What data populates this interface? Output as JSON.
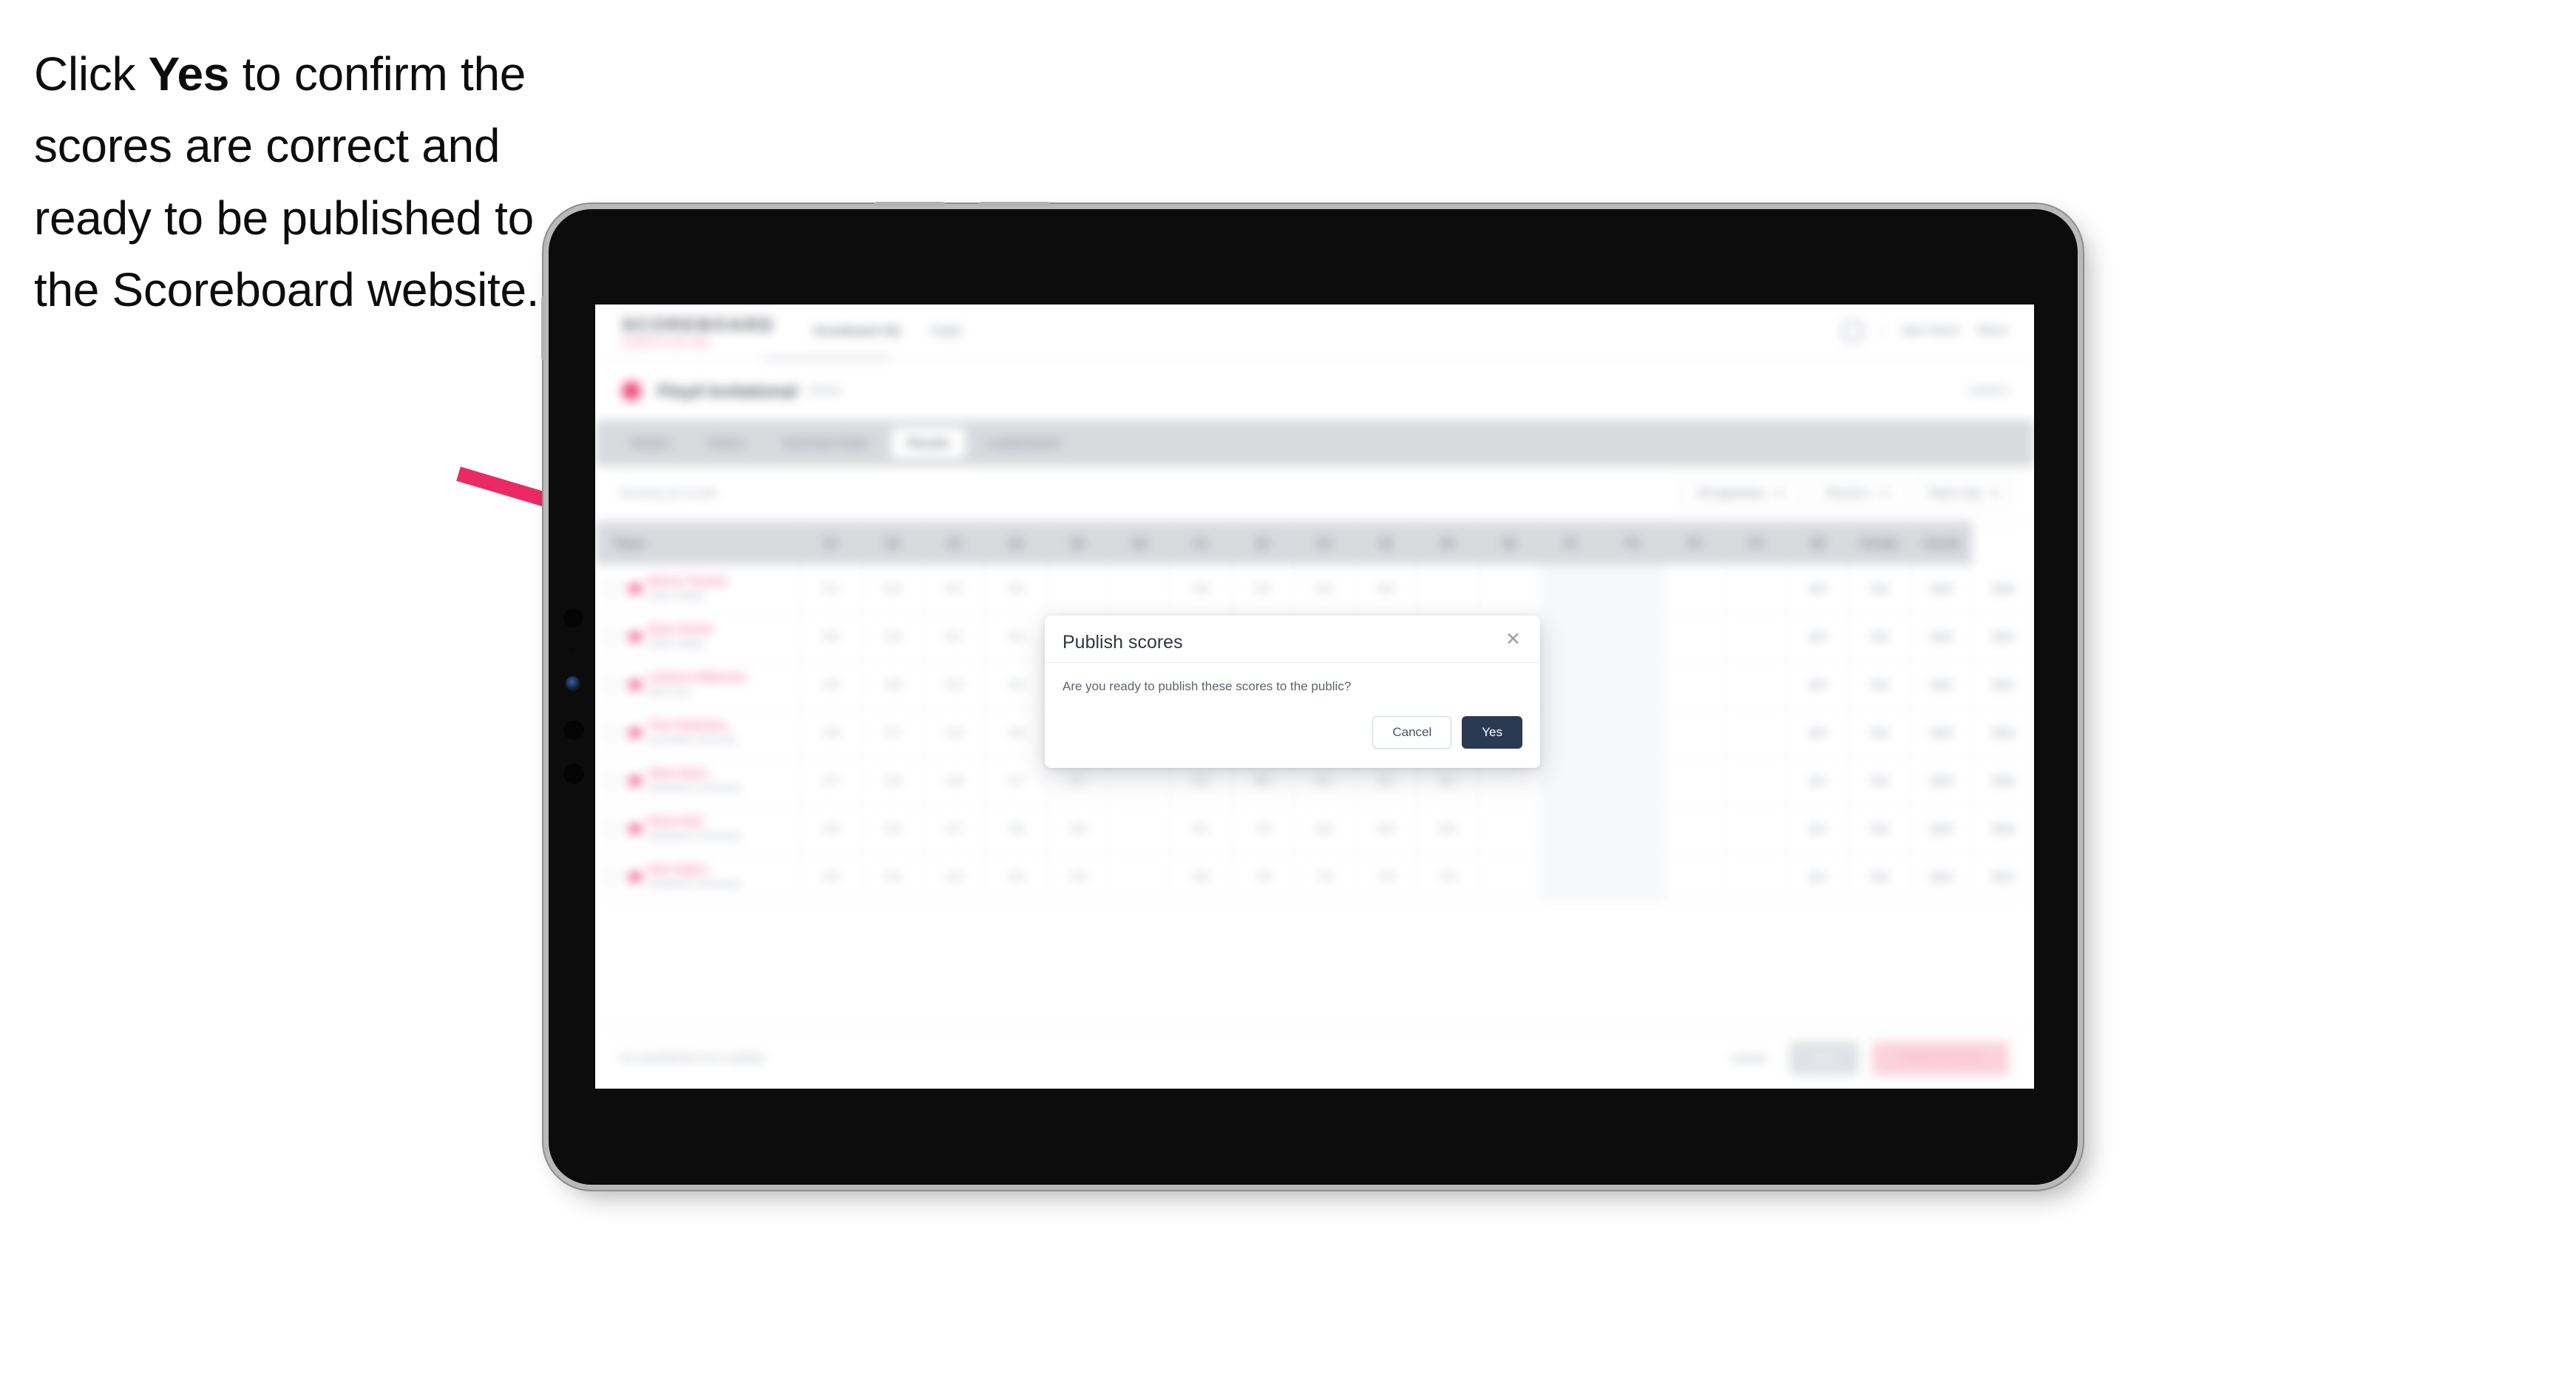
{
  "instruction": {
    "part1": "Click ",
    "emphasis": "Yes",
    "part2": " to confirm the scores are correct and ready to be published to the Scoreboard website."
  },
  "annotation": {
    "arrow_color": "#ea2a63",
    "arrow_name": "pink-pointer-arrow"
  },
  "device": {
    "type": "tablet",
    "orientation": "landscape",
    "frame_color": "#0c0c0c",
    "edge_color": "#b9b9b9"
  },
  "app": {
    "brand": {
      "name": "SCOREBOARD",
      "tagline": "COMPETITION HUB"
    },
    "nav": [
      {
        "label": "Scoreboard HQ",
        "active": true
      },
      {
        "label": "Feed",
        "active": false
      }
    ],
    "header_right": {
      "bell": "bell-icon",
      "user_name": "Sam Davis",
      "menu": "Menu"
    },
    "competition": {
      "title": "Floyd Invitational",
      "subtitle": "Event",
      "right_label": "Level 3"
    },
    "tabs": [
      {
        "label": "Details",
        "active": false
      },
      {
        "label": "Teams",
        "active": false
      },
      {
        "label": "Gymnast Order",
        "active": false
      },
      {
        "label": "Results",
        "active": true
      },
      {
        "label": "Leaderboard",
        "active": false
      }
    ],
    "filters": {
      "left_label": "Showing all results",
      "select_apparatus": "All apparatus",
      "select_round": "Round 1",
      "select_display": "Team only"
    },
    "table": {
      "columns": [
        "Player",
        "D1",
        "D2",
        "D3",
        "D4",
        "D5",
        "D6",
        "E1",
        "E2",
        "E3",
        "E4",
        "E5",
        "E6",
        "P1",
        "P2",
        "P3",
        "P4",
        "SB",
        "Penalty",
        "Overall"
      ],
      "rows": [
        {
          "name": "Marcus Tennant",
          "club": "Floyd College",
          "cells": [
            "5.1",
            "5.0",
            "5.2",
            "5.0",
            "",
            "",
            "8.6",
            "8.4",
            "8.5",
            "8.5",
            "",
            "",
            "",
            "",
            "",
            "",
            "0.0",
            "0.3",
            "13.6",
            "13.6"
          ]
        },
        {
          "name": "Ryan Parnell",
          "club": "Floyd College",
          "cells": [
            "5.0",
            "4.9",
            "5.1",
            "5.0",
            "",
            "",
            "8.5",
            "8.3",
            "8.4",
            "8.4",
            "",
            "",
            "",
            "",
            "",
            "",
            "0.0",
            "0.3",
            "13.4",
            "13.4"
          ]
        },
        {
          "name": "Cameron Blakeman",
          "club": "Bush Park",
          "cells": [
            "4.9",
            "4.8",
            "5.0",
            "4.9",
            "",
            "",
            "8.4",
            "8.2",
            "8.3",
            "8.3",
            "",
            "",
            "",
            "",
            "",
            "",
            "0.0",
            "0.3",
            "13.2",
            "13.2"
          ]
        },
        {
          "name": "Theo Robertson",
          "club": "Hernandez University",
          "cells": [
            "4.8",
            "4.7",
            "4.9",
            "4.8",
            "4.8",
            "",
            "8.3",
            "8.1",
            "8.2",
            "8.2",
            "8.2",
            "",
            "",
            "",
            "",
            "",
            "0.0",
            "0.3",
            "13.0",
            "13.0"
          ]
        },
        {
          "name": "Oliver Bown",
          "club": "Southwest Community",
          "cells": [
            "4.7",
            "4.6",
            "4.8",
            "4.7",
            "4.7",
            "",
            "8.2",
            "8.0",
            "8.1",
            "8.1",
            "8.1",
            "",
            "",
            "",
            "",
            "",
            "0.1",
            "0.3",
            "12.8",
            "12.8"
          ]
        },
        {
          "name": "Reece Bolt",
          "club": "Southwest Community",
          "cells": [
            "4.6",
            "4.5",
            "4.7",
            "4.6",
            "4.6",
            "",
            "8.1",
            "7.9",
            "8.0",
            "8.0",
            "8.0",
            "",
            "",
            "",
            "",
            "",
            "0.1",
            "0.3",
            "12.6",
            "12.6"
          ]
        },
        {
          "name": "Nick Sadeur",
          "club": "Southwest Community",
          "cells": [
            "4.5",
            "4.4",
            "4.6",
            "4.5",
            "4.5",
            "",
            "8.0",
            "7.8",
            "7.9",
            "7.9",
            "7.9",
            "",
            "",
            "",
            "",
            "",
            "0.1",
            "0.3",
            "12.4",
            "12.4"
          ]
        }
      ]
    },
    "bottom_bar": {
      "note": "No unpublished score updates",
      "link_label": "Cancel",
      "secondary_button": "Save",
      "primary_button": "Publish all scores"
    }
  },
  "modal": {
    "title": "Publish scores",
    "close_icon": "close-icon",
    "message": "Are you ready to publish these scores to the public?",
    "cancel_label": "Cancel",
    "confirm_label": "Yes",
    "confirm_color": "#2b3a52"
  }
}
